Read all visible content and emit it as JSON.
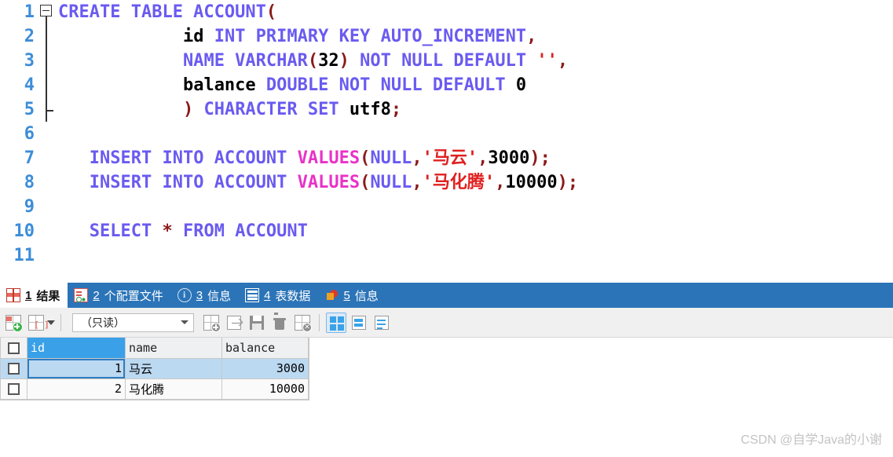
{
  "editor": {
    "lines": [
      {
        "num": "1",
        "fold": "start",
        "indent": 0,
        "tokens": [
          {
            "t": "CREATE TABLE ACCOUNT",
            "c": "kw"
          },
          {
            "t": "(",
            "c": "punct"
          }
        ]
      },
      {
        "num": "2",
        "indent": 4,
        "tokens": [
          {
            "t": "id",
            "c": "ident"
          },
          {
            "t": " ",
            "c": "plain"
          },
          {
            "t": "INT PRIMARY KEY AUTO_INCREMENT",
            "c": "kw"
          },
          {
            "t": ",",
            "c": "punct"
          }
        ]
      },
      {
        "num": "3",
        "indent": 4,
        "tokens": [
          {
            "t": "NAME VARCHAR",
            "c": "kw"
          },
          {
            "t": "(",
            "c": "punct"
          },
          {
            "t": "32",
            "c": "num"
          },
          {
            "t": ")",
            "c": "punct"
          },
          {
            "t": " ",
            "c": "plain"
          },
          {
            "t": "NOT NULL DEFAULT",
            "c": "kw"
          },
          {
            "t": " ",
            "c": "plain"
          },
          {
            "t": "''",
            "c": "str"
          },
          {
            "t": ",",
            "c": "punct"
          }
        ]
      },
      {
        "num": "4",
        "indent": 4,
        "tokens": [
          {
            "t": "balance",
            "c": "ident"
          },
          {
            "t": " ",
            "c": "plain"
          },
          {
            "t": "DOUBLE NOT NULL DEFAULT",
            "c": "kw"
          },
          {
            "t": " ",
            "c": "plain"
          },
          {
            "t": "0",
            "c": "num"
          }
        ]
      },
      {
        "num": "5",
        "fold": "end",
        "indent": 4,
        "tokens": [
          {
            "t": ")",
            "c": "punct"
          },
          {
            "t": " ",
            "c": "plain"
          },
          {
            "t": "CHARACTER SET",
            "c": "kw"
          },
          {
            "t": " ",
            "c": "plain"
          },
          {
            "t": "utf8",
            "c": "ident"
          },
          {
            "t": ";",
            "c": "punct"
          }
        ]
      },
      {
        "num": "6",
        "indent": 0,
        "tokens": []
      },
      {
        "num": "7",
        "indent": 1,
        "tokens": [
          {
            "t": "INSERT INTO ACCOUNT ",
            "c": "kw"
          },
          {
            "t": "VALUES",
            "c": "kw2"
          },
          {
            "t": "(",
            "c": "punct"
          },
          {
            "t": "NULL",
            "c": "kw"
          },
          {
            "t": ",",
            "c": "punct"
          },
          {
            "t": "'马云'",
            "c": "str"
          },
          {
            "t": ",",
            "c": "punct"
          },
          {
            "t": "3000",
            "c": "num"
          },
          {
            "t": ");",
            "c": "punct"
          }
        ]
      },
      {
        "num": "8",
        "indent": 1,
        "tokens": [
          {
            "t": "INSERT INTO ACCOUNT ",
            "c": "kw"
          },
          {
            "t": "VALUES",
            "c": "kw2"
          },
          {
            "t": "(",
            "c": "punct"
          },
          {
            "t": "NULL",
            "c": "kw"
          },
          {
            "t": ",",
            "c": "punct"
          },
          {
            "t": "'马化腾'",
            "c": "str"
          },
          {
            "t": ",",
            "c": "punct"
          },
          {
            "t": "10000",
            "c": "num"
          },
          {
            "t": ");",
            "c": "punct"
          }
        ]
      },
      {
        "num": "9",
        "indent": 0,
        "tokens": []
      },
      {
        "num": "10",
        "indent": 1,
        "tokens": [
          {
            "t": "SELECT ",
            "c": "kw"
          },
          {
            "t": "*",
            "c": "punct"
          },
          {
            "t": " ",
            "c": "plain"
          },
          {
            "t": "FROM ACCOUNT",
            "c": "kw"
          }
        ]
      },
      {
        "num": "11",
        "indent": 0,
        "tokens": []
      }
    ]
  },
  "result_tabs": [
    {
      "num": "1",
      "label": "结果",
      "icon": "result-grid-icon",
      "active": true
    },
    {
      "num": "2",
      "label": "个配置文件",
      "icon": "profile-icon",
      "active": false
    },
    {
      "num": "3",
      "label": "信息",
      "icon": "info-circle-icon",
      "active": false
    },
    {
      "num": "4",
      "label": "表数据",
      "icon": "table-data-icon",
      "active": false
    },
    {
      "num": "5",
      "label": "信息",
      "icon": "chart-pie-icon",
      "active": false
    }
  ],
  "toolbar": {
    "mode_value": "（只读）",
    "buttons": [
      {
        "name": "add-record-button",
        "icon": "grid-plus-icon"
      },
      {
        "name": "grid-options-button",
        "icon": "grid-brackets-icon"
      },
      {
        "name": "insert-record-button",
        "icon": "grid-add-icon"
      },
      {
        "name": "export-record-button",
        "icon": "grid-export-icon"
      },
      {
        "name": "apply-changes-button",
        "icon": "save-floppy-icon"
      },
      {
        "name": "delete-record-button",
        "icon": "trash-icon"
      },
      {
        "name": "cancel-changes-button",
        "icon": "grid-cancel-icon"
      },
      {
        "name": "view-grid-button",
        "icon": "view-grid-icon"
      },
      {
        "name": "view-form-button",
        "icon": "view-form-icon"
      },
      {
        "name": "view-text-button",
        "icon": "view-text-icon"
      }
    ]
  },
  "grid": {
    "columns": [
      "id",
      "name",
      "balance"
    ],
    "rows": [
      {
        "id": "1",
        "name": "马云",
        "balance": "3000",
        "selected": true
      },
      {
        "id": "2",
        "name": "马化腾",
        "balance": "10000",
        "selected": false
      }
    ]
  },
  "watermark": "CSDN @自学Java的小谢"
}
